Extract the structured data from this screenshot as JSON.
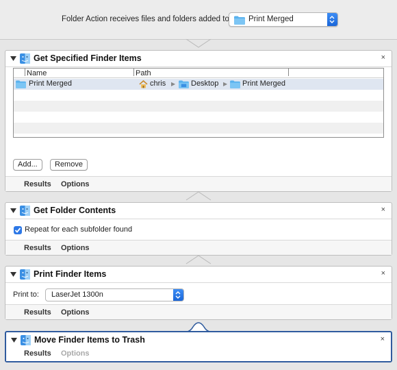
{
  "header": {
    "label": "Folder Action receives files and folders added to",
    "folder": "Print Merged"
  },
  "actions": [
    {
      "title": "Get Specified Finder Items",
      "table": {
        "columns": [
          "Name",
          "Path"
        ],
        "rows": [
          {
            "name": "Print Merged",
            "path": [
              "chris",
              "Desktop",
              "Print Merged"
            ]
          }
        ]
      },
      "buttons": [
        "Add...",
        "Remove"
      ],
      "footer": [
        "Results",
        "Options"
      ]
    },
    {
      "title": "Get Folder Contents",
      "checkbox": {
        "label": "Repeat for each subfolder found",
        "checked": true
      },
      "footer": [
        "Results",
        "Options"
      ]
    },
    {
      "title": "Print Finder Items",
      "print_to_label": "Print to:",
      "printer": "LaserJet 1300n",
      "footer": [
        "Results",
        "Options"
      ]
    },
    {
      "title": "Move Finder Items to Trash",
      "footer": [
        "Results",
        "Options"
      ],
      "options_disabled": true
    }
  ],
  "close_glyph": "×",
  "colors": {
    "accent": "#2d78e6",
    "selected_border": "#2f5b9e",
    "folder": "#5ab2ee"
  }
}
